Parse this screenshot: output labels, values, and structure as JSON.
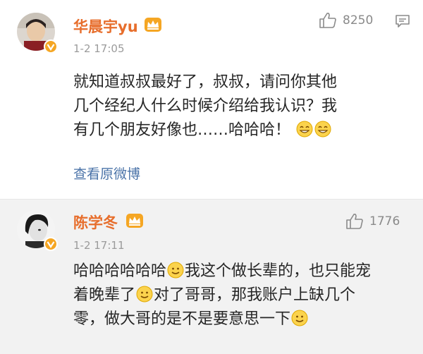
{
  "comments": [
    {
      "username": "华晨宇yu",
      "time": "1-2 17:05",
      "likes": "8250",
      "text_lines": [
        "就知道叔叔最好了，叔叔，请问你其他",
        "几个经纪人什么时候介绍给我认识？我",
        "有几个朋友好像也……哈哈哈！"
      ],
      "view_original": "查看原微博"
    },
    {
      "username": "陈学冬",
      "time": "1-2 17:11",
      "likes": "1776",
      "line1_a": "哈哈哈哈哈哈",
      "line1_b": "我这个做长辈的，也只能宠",
      "line2_a": "着晚辈了",
      "line2_b": "对了哥哥，那我账户上缺几个",
      "line3_a": "零，做大哥的是不是要意思一下"
    }
  ],
  "colors": {
    "username": "#e76e2c",
    "link": "#4a73a8",
    "meta": "#9b9b9b",
    "crown": "#f5a623",
    "verify": "#f5a623"
  },
  "icons": [
    "crown-icon",
    "verified-badge-icon",
    "thumbs-up-icon",
    "reply-icon",
    "smile-emoji-icon",
    "grin-emoji-icon"
  ]
}
